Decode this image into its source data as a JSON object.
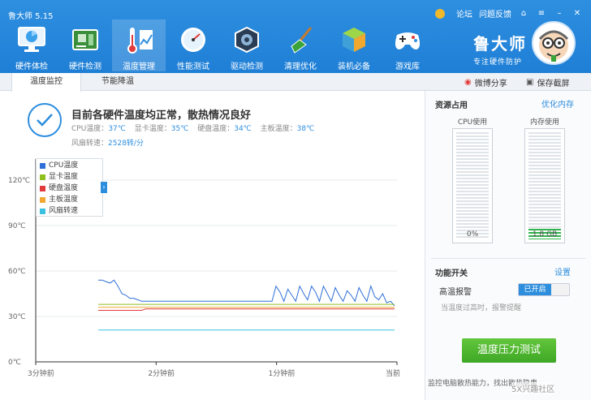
{
  "window": {
    "title": "鲁大师 5.15",
    "links": [
      "论坛",
      "问题反馈"
    ]
  },
  "nav": [
    {
      "label": "硬件体检",
      "icon": "monitor-icon"
    },
    {
      "label": "硬件检测",
      "icon": "circuit-board-icon"
    },
    {
      "label": "温度管理",
      "icon": "thermometer-icon"
    },
    {
      "label": "性能测试",
      "icon": "speedometer-icon"
    },
    {
      "label": "驱动检测",
      "icon": "gear-chip-icon"
    },
    {
      "label": "清理优化",
      "icon": "broom-icon"
    },
    {
      "label": "装机必备",
      "icon": "cube-icon"
    },
    {
      "label": "游戏库",
      "icon": "gamepad-icon"
    }
  ],
  "brand": {
    "name": "鲁大师",
    "slogan": "专注硬件防护"
  },
  "tabs": {
    "monitor": "温度监控",
    "cooling": "节能降温",
    "share": "微博分享",
    "screenshot": "保存截屏"
  },
  "status": {
    "title": "目前各硬件温度均正常，散热情况良好",
    "cpu_label": "CPU温度：",
    "cpu": "37℃",
    "gpu_label": "显卡温度：",
    "gpu": "35℃",
    "disk_label": "硬盘温度：",
    "disk": "34℃",
    "board_label": "主板温度：",
    "board": "38℃",
    "fan_label": "风扇转速：",
    "fan": "2528转/分"
  },
  "chart_data": {
    "type": "line",
    "x": [
      "3分钟前",
      "2分钟前",
      "1分钟前",
      "当前"
    ],
    "yticks": [
      "0℃",
      "30℃",
      "60℃",
      "90℃",
      "120℃"
    ],
    "ylim": [
      0,
      120
    ],
    "legend_placement": "top-left",
    "series": [
      {
        "name": "CPU温度",
        "color": "#2e6fd8",
        "values": [
          54,
          54,
          53,
          52,
          54,
          50,
          45,
          44,
          42,
          42,
          41,
          40,
          40,
          40,
          40,
          40,
          40,
          40,
          40,
          40,
          40,
          40,
          40,
          40,
          40,
          40,
          40,
          40,
          40,
          40,
          40,
          40,
          40,
          40,
          40,
          40,
          40,
          40,
          40,
          40,
          40,
          40,
          40,
          40,
          40,
          50,
          46,
          40,
          48,
          44,
          40,
          50,
          45,
          41,
          50,
          46,
          40,
          50,
          45,
          40,
          49,
          44,
          40,
          47,
          44,
          40,
          49,
          44,
          40,
          50,
          43,
          41,
          45,
          39,
          40,
          37
        ]
      },
      {
        "name": "显卡温度",
        "color": "#8fbf1f",
        "values": [
          38,
          38,
          38,
          38,
          38,
          38,
          38,
          38,
          38,
          38,
          38,
          38,
          38,
          38,
          38,
          38,
          38,
          38,
          38,
          38,
          38,
          38,
          38,
          38,
          38,
          38,
          38,
          38,
          38,
          38,
          38,
          38,
          38,
          38,
          38,
          38,
          38,
          38,
          38,
          38,
          38,
          38,
          38,
          38,
          38,
          38,
          38,
          38,
          38,
          38,
          38,
          38,
          38,
          38,
          38,
          38,
          38,
          38,
          38,
          38,
          38,
          38,
          38,
          38,
          38,
          38,
          38,
          38,
          38,
          38,
          38,
          38,
          38,
          38,
          38,
          38
        ]
      },
      {
        "name": "硬盘温度",
        "color": "#e23b3b",
        "values": [
          34,
          34,
          34,
          34,
          34,
          34,
          34,
          34,
          34,
          34,
          34,
          34,
          35,
          35,
          35,
          35,
          35,
          35,
          35,
          35,
          35,
          35,
          35,
          35,
          35,
          35,
          35,
          35,
          35,
          35,
          35,
          35,
          35,
          35,
          35,
          35,
          35,
          35,
          35,
          35,
          35,
          35,
          35,
          35,
          35,
          35,
          35,
          35,
          35,
          35,
          35,
          35,
          35,
          35,
          35,
          35,
          35,
          35,
          35,
          35,
          35,
          35,
          35,
          35,
          35,
          35,
          35,
          35,
          35,
          35,
          35,
          35,
          35,
          35,
          35,
          35
        ]
      },
      {
        "name": "主板温度",
        "color": "#f0a830",
        "values": [
          36,
          36,
          36,
          36,
          36,
          36,
          36,
          36,
          36,
          36,
          36,
          36,
          36,
          36,
          36,
          36,
          36,
          36,
          36,
          36,
          36,
          36,
          36,
          36,
          36,
          36,
          36,
          36,
          36,
          36,
          36,
          36,
          36,
          36,
          36,
          36,
          36,
          36,
          36,
          36,
          36,
          36,
          36,
          36,
          36,
          36,
          36,
          36,
          36,
          36,
          36,
          36,
          36,
          36,
          36,
          36,
          36,
          36,
          36,
          36,
          36,
          36,
          36,
          36,
          36,
          36,
          36,
          36,
          36,
          36,
          36,
          36,
          36,
          36,
          36,
          36
        ]
      },
      {
        "name": "风扇转速",
        "color": "#3cc0e0",
        "values": [
          21,
          21,
          21,
          21,
          21,
          21,
          21,
          21,
          21,
          21,
          21,
          21,
          21,
          21,
          21,
          21,
          21,
          21,
          21,
          21,
          21,
          21,
          21,
          21,
          21,
          21,
          21,
          21,
          21,
          21,
          21,
          21,
          21,
          21,
          21,
          21,
          21,
          21,
          21,
          21,
          21,
          21,
          21,
          21,
          21,
          21,
          21,
          21,
          21,
          21,
          21,
          21,
          21,
          21,
          21,
          21,
          21,
          21,
          21,
          21,
          21,
          21,
          21,
          21,
          21,
          21,
          21,
          21,
          21,
          21,
          21,
          21,
          21,
          21,
          21,
          21
        ]
      }
    ]
  },
  "side": {
    "resource_title": "资源占用",
    "optimize": "优化内存",
    "cpu_label": "CPU使用",
    "cpu_value": "0%",
    "cpu_fraction": 0,
    "mem_label": "内存使用",
    "mem_value": "1.8 GB",
    "mem_fraction": 0.1,
    "func_title": "功能开关",
    "settings": "设置",
    "alarm_label": "高温报警",
    "alarm_state": "已开启",
    "alarm_hint": "当温度过高时，报警提醒",
    "stress_button": "温度压力测试",
    "footer": "监控电脑散热能力，找出散热隐患"
  },
  "watermark": "5X兴趣社区"
}
